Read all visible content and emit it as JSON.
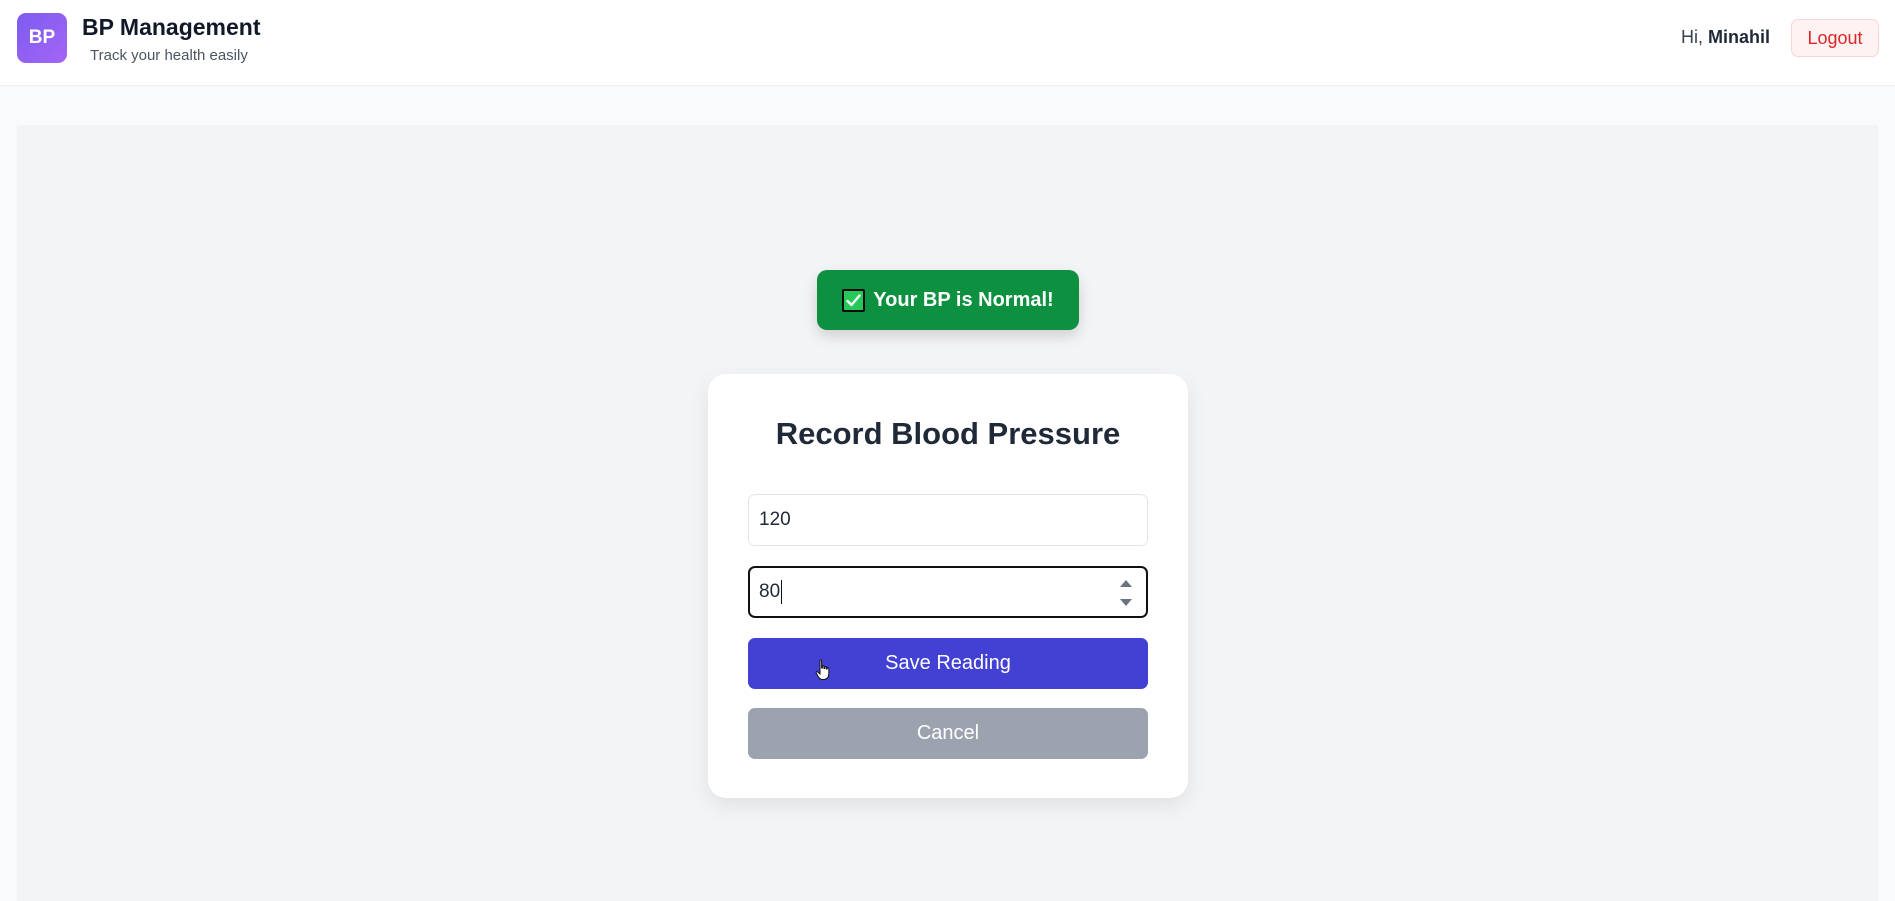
{
  "header": {
    "logo_text": "BP",
    "title": "BP Management",
    "subtitle": "Track your health easily",
    "greeting_prefix": "Hi, ",
    "username": "Minahil",
    "logout_label": "Logout"
  },
  "toast": {
    "icon": "check-icon",
    "message": "Your BP is Normal!",
    "color": "#0d9140"
  },
  "form": {
    "title": "Record Blood Pressure",
    "systolic_value": "120",
    "diastolic_value": "80",
    "save_label": "Save Reading",
    "cancel_label": "Cancel"
  },
  "colors": {
    "accent": "#4340d4",
    "cancel": "#9ca3af",
    "logout": "#dc2626",
    "brand_gradient_start": "#7c5cf0",
    "brand_gradient_end": "#a465f5"
  }
}
